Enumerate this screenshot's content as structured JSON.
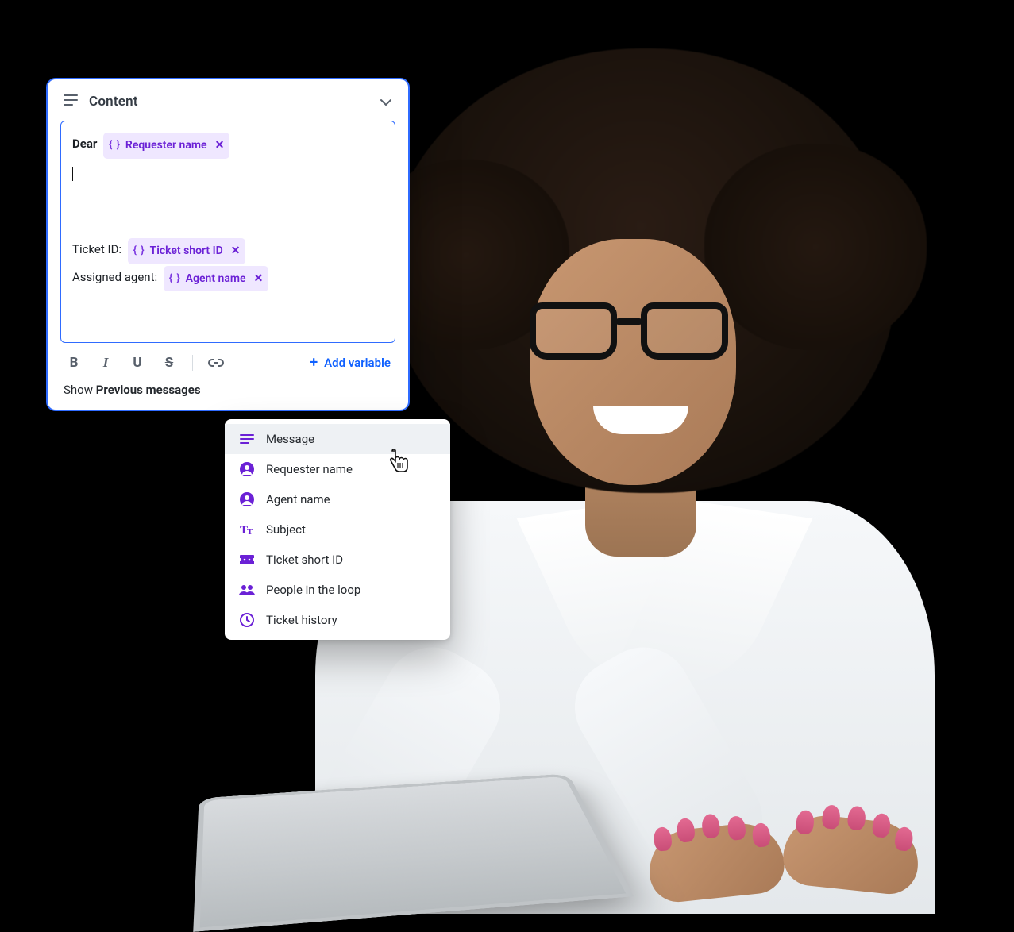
{
  "card": {
    "title": "Content"
  },
  "editor": {
    "greeting_prefix": "Dear",
    "chips": {
      "requester_name": "Requester name",
      "ticket_short_id": "Ticket short ID",
      "agent_name": "Agent name"
    },
    "lines": {
      "ticket_id_label": "Ticket ID:",
      "assigned_agent_label": "Assigned agent:"
    }
  },
  "toolbar": {
    "bold": "B",
    "italic": "I",
    "underline": "U",
    "strike": "S",
    "add_variable_label": "Add variable"
  },
  "footer": {
    "show_prefix": "Show ",
    "previous_messages": "Previous messages"
  },
  "dropdown": {
    "items": [
      {
        "icon": "list",
        "label": "Message"
      },
      {
        "icon": "person",
        "label": "Requester name"
      },
      {
        "icon": "person",
        "label": "Agent name"
      },
      {
        "icon": "text",
        "label": "Subject"
      },
      {
        "icon": "ticket",
        "label": "Ticket short ID"
      },
      {
        "icon": "people",
        "label": "People in the loop"
      },
      {
        "icon": "clock",
        "label": "Ticket history"
      }
    ]
  },
  "colors": {
    "accent_blue": "#2f6bff",
    "accent_purple": "#6b21d6",
    "chip_bg": "#efe7ff"
  }
}
